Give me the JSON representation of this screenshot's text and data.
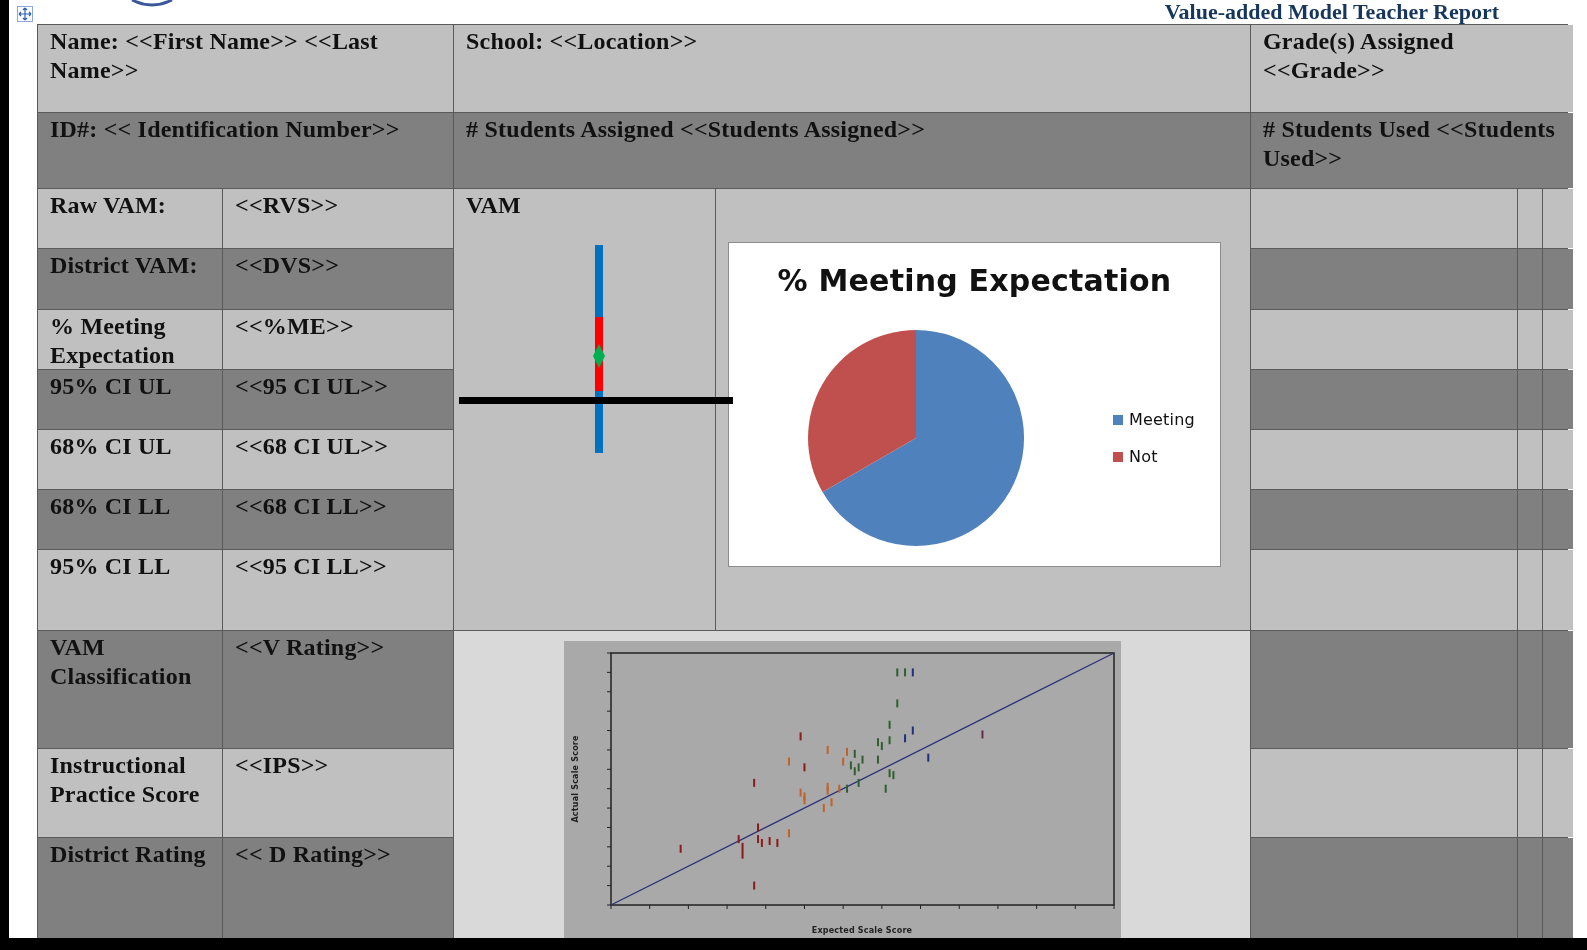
{
  "document": {
    "title": "Value-added Model Teacher Report"
  },
  "header_rows": [
    {
      "shaded": false,
      "cells": [
        "Name: <<First Name>> <<Last Name>>",
        "School:  <<Location>>",
        "Grade(s) Assigned <<Grade>>"
      ]
    },
    {
      "shaded": true,
      "cells": [
        "ID#:  << Identification Number>>",
        "# Students Assigned <<Students Assigned>>",
        "# Students Used <<Students Used>>"
      ]
    }
  ],
  "metrics": [
    {
      "label": "Raw VAM:",
      "value": "<<RVS>>",
      "shaded": false
    },
    {
      "label": "District VAM:",
      "value": "<<DVS>>",
      "shaded": true
    },
    {
      "label": "% Meeting Expectation",
      "value": "<<%ME>>",
      "shaded": false
    },
    {
      "label": "95% CI UL",
      "value": "<<95 CI UL>>",
      "shaded": true
    },
    {
      "label": "68% CI UL",
      "value": "<<68 CI UL>>",
      "shaded": false
    },
    {
      "label": "68% CI LL",
      "value": "<<68 CI LL>>",
      "shaded": true
    },
    {
      "label": "95% CI LL",
      "value": "<<95 CI LL>>",
      "shaded": false
    }
  ],
  "vam_panel": {
    "label": "VAM"
  },
  "pie_chart": {
    "title": "% Meeting Expectation",
    "legend": [
      {
        "label": "Meeting",
        "color": "#4f81bd"
      },
      {
        "label": "Not",
        "color": "#c0504d"
      }
    ]
  },
  "ratings": [
    {
      "label": "VAM Classification",
      "value": "<<V Rating>>",
      "shaded": true
    },
    {
      "label": "Instructional Practice Score",
      "value": "<<IPS>>",
      "shaded": false
    },
    {
      "label": "District Rating",
      "value": "<< D Rating>>",
      "shaded": true
    }
  ],
  "scatter_plot": {
    "xlabel": "Expected Scale Score",
    "ylabel": "Actual Scale Score"
  }
}
